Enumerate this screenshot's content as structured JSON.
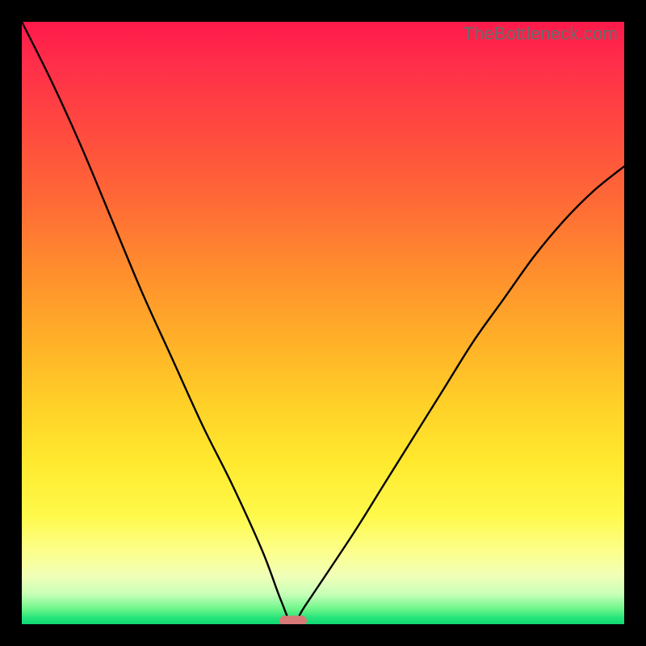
{
  "watermark": "TheBottleneck.com",
  "chart_data": {
    "type": "line",
    "title": "",
    "xlabel": "",
    "ylabel": "",
    "xlim": [
      0,
      100
    ],
    "ylim": [
      0,
      100
    ],
    "series": [
      {
        "name": "bottleneck-curve",
        "x": [
          0,
          5,
          10,
          15,
          20,
          25,
          30,
          35,
          40,
          43,
          45,
          47,
          55,
          60,
          65,
          70,
          75,
          80,
          85,
          90,
          95,
          100
        ],
        "values": [
          100,
          90,
          79,
          67,
          55,
          44,
          33,
          23,
          12,
          4,
          0,
          3,
          15,
          23,
          31,
          39,
          47,
          54,
          61,
          67,
          72,
          76
        ]
      }
    ],
    "minimum_marker": {
      "x": 45,
      "y": 0
    },
    "gradient_stops": [
      {
        "pos": 0,
        "color": "#ff1a4b"
      },
      {
        "pos": 0.5,
        "color": "#ffcf28"
      },
      {
        "pos": 0.9,
        "color": "#fcff8c"
      },
      {
        "pos": 1.0,
        "color": "#11d873"
      }
    ]
  }
}
